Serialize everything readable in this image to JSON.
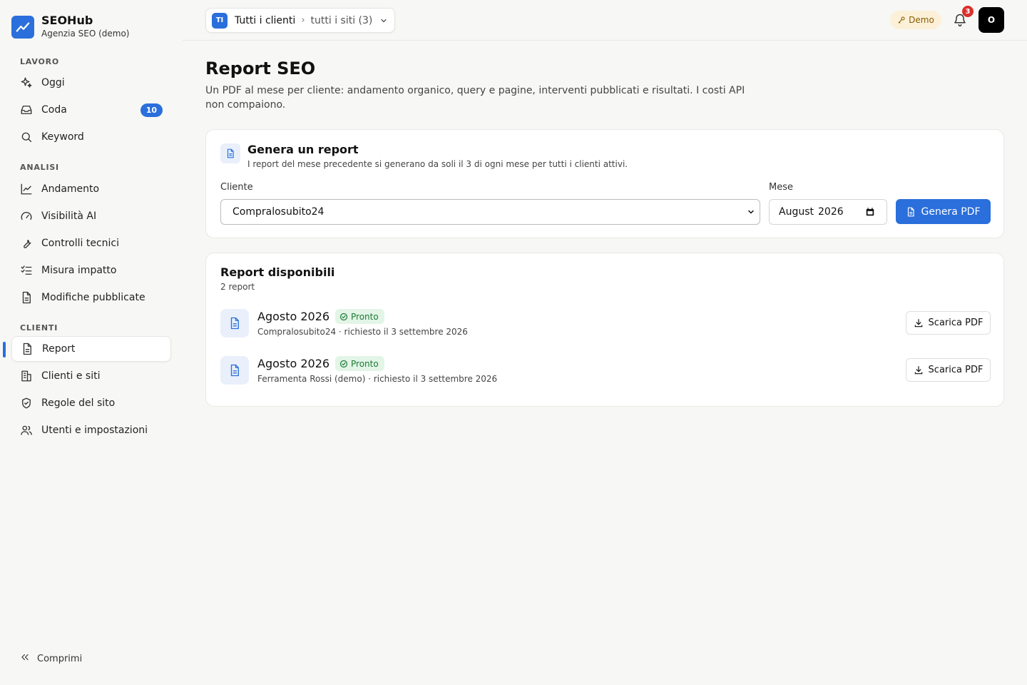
{
  "app": {
    "name": "SEOHub",
    "subtitle": "Agenzia SEO (demo)"
  },
  "sidebar": {
    "sections": [
      {
        "label": "LAVORO"
      },
      {
        "label": "ANALISI"
      },
      {
        "label": "CLIENTI"
      }
    ],
    "items": [
      {
        "label": "Oggi",
        "icon": "sparkles-icon"
      },
      {
        "label": "Coda",
        "icon": "inbox-icon",
        "badge": "10"
      },
      {
        "label": "Keyword",
        "icon": "search-icon"
      },
      {
        "label": "Andamento",
        "icon": "line-chart-icon"
      },
      {
        "label": "Visibilità AI",
        "icon": "gauge-icon"
      },
      {
        "label": "Controlli tecnici",
        "icon": "wrench-icon"
      },
      {
        "label": "Misura impatto",
        "icon": "checklist-icon"
      },
      {
        "label": "Modifiche pubblicate",
        "icon": "document-icon"
      },
      {
        "label": "Report",
        "icon": "document-icon",
        "active": true
      },
      {
        "label": "Clienti e siti",
        "icon": "building-icon"
      },
      {
        "label": "Regole del sito",
        "icon": "shield-check-icon"
      },
      {
        "label": "Utenti e impostazioni",
        "icon": "users-icon"
      }
    ],
    "collapse_label": "Comprimi"
  },
  "topbar": {
    "client_initials": "TI",
    "client_label": "Tutti i clienti",
    "separator": "›",
    "sites_label": "tutti i siti (3)",
    "demo_label": "Demo",
    "notifications_count": "3",
    "avatar_initial": "O"
  },
  "page": {
    "title": "Report SEO",
    "description": "Un PDF al mese per cliente: andamento organico, query e pagine, interventi pubblicati e risultati. I costi API non compaiono."
  },
  "generate": {
    "title": "Genera un report",
    "subtitle": "I report del mese precedente si generano da soli il 3 di ogni mese per tutti i clienti attivi.",
    "client_label": "Cliente",
    "client_value": "Compralosubito24",
    "month_label": "Mese",
    "month_value": "August",
    "year_value": "2026",
    "button_label": "Genera PDF"
  },
  "reports": {
    "title": "Report disponibili",
    "count_label": "2 report",
    "items": [
      {
        "title": "Agosto 2026",
        "status": "Pronto",
        "meta": "Compralosubito24 · richiesto il 3 settembre 2026",
        "action": "Scarica PDF"
      },
      {
        "title": "Agosto 2026",
        "status": "Pronto",
        "meta": "Ferramenta Rossi (demo) · richiesto il 3 settembre 2026",
        "action": "Scarica PDF"
      }
    ]
  },
  "colors": {
    "accent": "#2a6fdb",
    "status_ok_bg": "#e3f5e6",
    "status_ok_text": "#1e7a35",
    "notification": "#d9302c",
    "demo_bg": "#fcf1d8"
  }
}
